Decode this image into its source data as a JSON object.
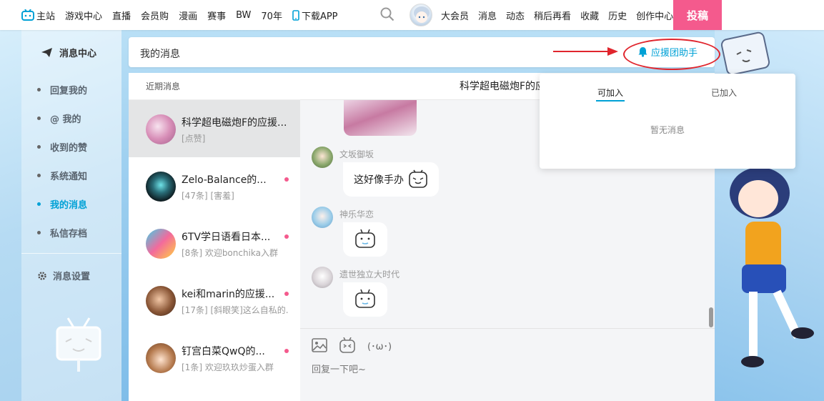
{
  "header": {
    "nav_left": [
      "主站",
      "游戏中心",
      "直播",
      "会员购",
      "漫画",
      "赛事",
      "BW",
      "70年",
      "下载APP"
    ],
    "nav_right": [
      "大会员",
      "消息",
      "动态",
      "稍后再看",
      "收藏",
      "历史",
      "创作中心"
    ],
    "post_button": "投稿",
    "icons": {
      "home": "tv-logo-icon",
      "download": "phone-icon",
      "search": "search-icon"
    }
  },
  "sidebar": {
    "title": "消息中心",
    "items": [
      {
        "label": "回复我的",
        "active": false
      },
      {
        "label": "@ 我的",
        "active": false
      },
      {
        "label": "收到的赞",
        "active": false
      },
      {
        "label": "系统通知",
        "active": false
      },
      {
        "label": "我的消息",
        "active": true
      },
      {
        "label": "私信存档",
        "active": false
      }
    ],
    "settings": "消息设置"
  },
  "message_bar": {
    "title": "我的消息",
    "helper_button": "应援团助手"
  },
  "conversations": {
    "heading": "近期消息",
    "items": [
      {
        "name": "科学超电磁炮F的应援...",
        "sub": "[点赞]",
        "unread": false,
        "active": true
      },
      {
        "name": "Zelo-Balance的...",
        "sub": "[47条] [害羞]",
        "unread": true,
        "active": false
      },
      {
        "name": "6TV学日语看日本...",
        "sub": "[8条] 欢迎bonchika入群",
        "unread": true,
        "active": false
      },
      {
        "name": "kei和marin的应援...",
        "sub": "[17条] [斜眼笑]这么自私的...",
        "unread": true,
        "active": false
      },
      {
        "name": "钉宫白菜QwQ的...",
        "sub": "[1条] 欢迎玖玖炒蛋入群",
        "unread": true,
        "active": false
      }
    ]
  },
  "chat": {
    "title": "科学超电磁炮F的应援",
    "messages": [
      {
        "sender": "文坂御坂",
        "text": "这好像手办",
        "emoji": "bili-face-icon"
      },
      {
        "sender": "神乐华恋",
        "text": "",
        "emoji": "bili-tv-face-icon"
      },
      {
        "sender": "遗世独立大时代",
        "text": "",
        "emoji": "bili-tv-face-icon"
      }
    ],
    "composer": {
      "kaomoji": "(･ω･)",
      "placeholder": "回复一下吧~"
    }
  },
  "popup": {
    "tabs": [
      "可加入",
      "已加入"
    ],
    "empty": "暂无消息"
  },
  "colors": {
    "accent": "#00a1d6",
    "post": "#f45a8d",
    "unread": "#f45a8d",
    "annotation": "#e0252d"
  }
}
